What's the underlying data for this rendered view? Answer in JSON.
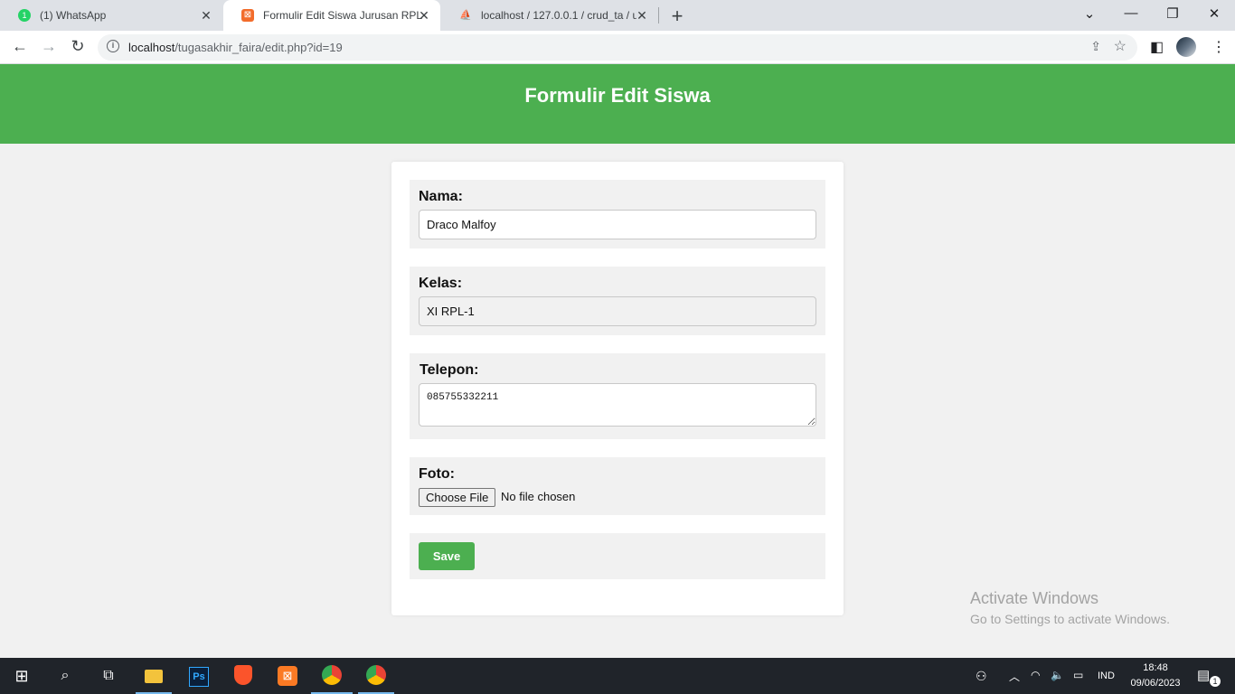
{
  "browser": {
    "tabs": [
      {
        "title": "(1) WhatsApp",
        "active": false,
        "favicon_color": "#25d366"
      },
      {
        "title": "Formulir Edit Siswa Jurusan RPL",
        "active": true,
        "favicon_color": "#f26c2b"
      },
      {
        "title": "localhost / 127.0.0.1 / crud_ta / u",
        "active": false,
        "favicon_color": "#f0a30a"
      }
    ],
    "url_host": "localhost",
    "url_path": "/tugasakhir_faira/edit.php?id=19"
  },
  "page": {
    "title": "Formulir Edit Siswa",
    "header_color": "#4caf50",
    "form": {
      "nama_label": "Nama:",
      "nama_value": "Draco Malfoy",
      "kelas_label": "Kelas:",
      "kelas_value": "XI RPL-1",
      "telepon_label": "Telepon:",
      "telepon_value": "085755332211",
      "foto_label": "Foto:",
      "file_button": "Choose File",
      "file_status": "No file chosen",
      "save_label": "Save"
    }
  },
  "watermark": {
    "line1": "Activate Windows",
    "line2": "Go to Settings to activate Windows."
  },
  "taskbar": {
    "language": "IND",
    "time": "18:48",
    "date": "09/06/2023",
    "notification_count": "1"
  }
}
